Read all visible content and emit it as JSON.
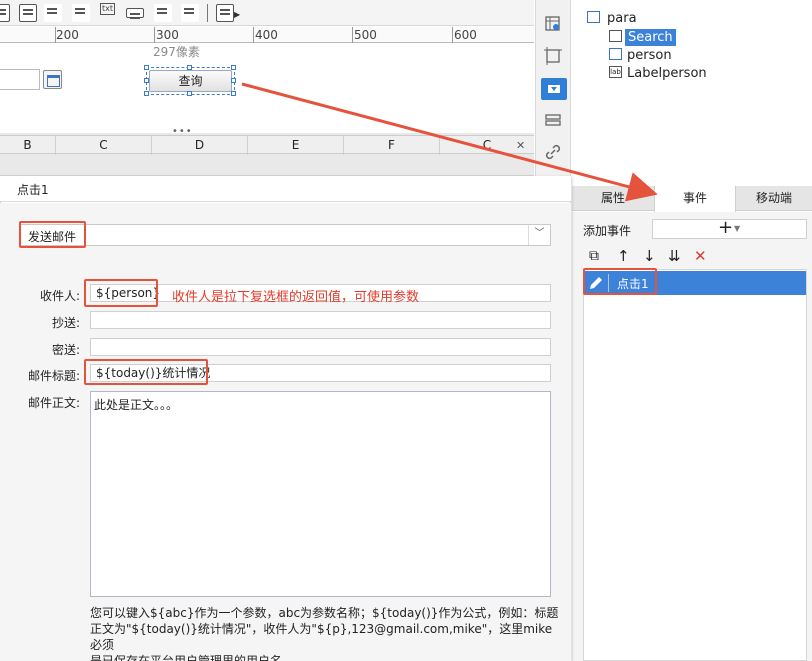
{
  "ruler": {
    "ticks": [
      "200",
      "300",
      "400",
      "500",
      "600"
    ],
    "pixel_hint": "297像素"
  },
  "canvas": {
    "query_button": "查询"
  },
  "grid": {
    "columns": [
      "B",
      "C",
      "D",
      "E",
      "F",
      "C"
    ]
  },
  "tree": {
    "root": "para",
    "items": [
      "Search",
      "person",
      "Labelperson"
    ]
  },
  "right_panel": {
    "tabs": [
      "属性",
      "事件",
      "移动端"
    ],
    "add_event_label": "添加事件",
    "add_event_plus": "+",
    "event_item": "点击1"
  },
  "dialog": {
    "title": "点击1",
    "action": "发送邮件",
    "fields": {
      "recipient_label": "收件人:",
      "recipient_value": "${person}",
      "cc_label": "抄送:",
      "bcc_label": "密送:",
      "subject_label": "邮件标题:",
      "subject_value": "${today()}统计情况",
      "body_label": "邮件正文:",
      "body_value": "此处是正文。。。"
    },
    "annotation": "收件人是拉下复选框的返回值，可使用参数",
    "help_line1": "您可以键入${abc}作为一个参数，abc为参数名称；${today()}作为公式，例如：标题",
    "help_line2": "正文为\"${today()}统计情况\"，收件人为\"${p},123@gmail.com,mike\"，这里mike必须",
    "help_line3": "是已保存在平台用户管理里的用户名"
  },
  "colors": {
    "accent": "#3b82d8",
    "callout": "#e5533d"
  }
}
